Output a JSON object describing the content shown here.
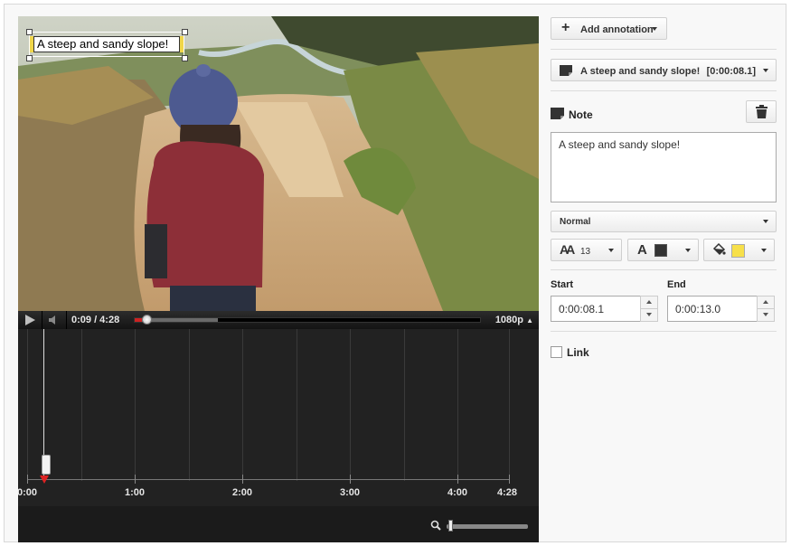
{
  "video": {
    "annotation_overlay_text": "A steep and sandy slope!",
    "annotation_colors": {
      "background": "#ffffff",
      "highlight": "#f0d64a"
    }
  },
  "player": {
    "time_display": "0:09 / 4:28",
    "quality": "1080p",
    "progress_played": 0.02,
    "progress_loaded": 0.24,
    "play_icon": "play-icon",
    "volume_icon": "volume-icon"
  },
  "timeline": {
    "labels": [
      "0:00",
      "1:00",
      "2:00",
      "3:00",
      "4:00",
      "4:28"
    ],
    "zoom_icon": "magnifier-icon",
    "zoom_level": 0.02
  },
  "panel": {
    "add_annotation_label": "Add annotation",
    "selected_annotation": {
      "label": "A steep and sandy slope!",
      "time": "[0:00:08.1]"
    },
    "note_title": "Note",
    "note_text": "A steep and sandy slope!",
    "style_value": "Normal",
    "font_size": "13",
    "font_color": "#333333",
    "background_color": "#f7e04a",
    "start_label": "Start",
    "start_value": "0:00:08.1",
    "end_label": "End",
    "end_value": "0:00:13.0",
    "link_label": "Link"
  }
}
